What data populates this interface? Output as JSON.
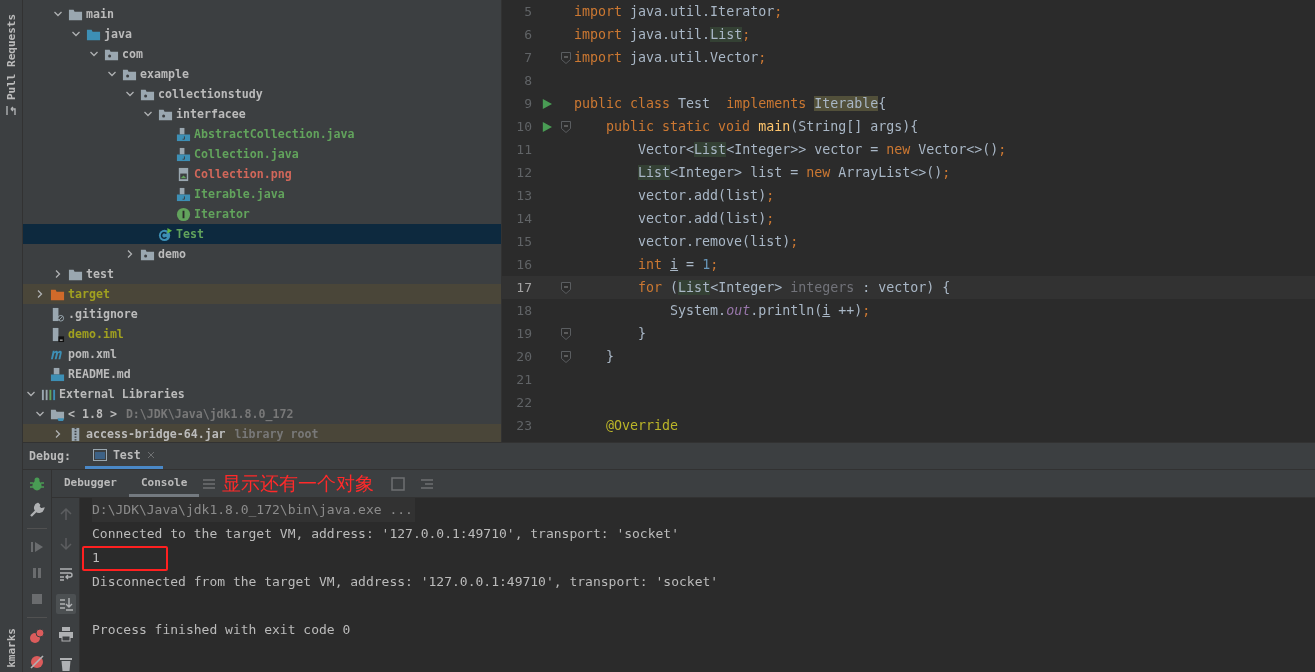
{
  "left_stripe": {
    "top_label": "Pull Requests",
    "bottom_label": "kmarks"
  },
  "project_tree": [
    {
      "children": [
        {
          "children": [
            {
              "label": "main",
              "kind": "folder",
              "expanded": true,
              "children": [
                {
                  "label": "java",
                  "kind": "source-folder",
                  "expanded": true,
                  "children": [
                    {
                      "label": "com",
                      "kind": "package",
                      "expanded": true,
                      "children": [
                        {
                          "label": "example",
                          "kind": "package",
                          "expanded": true,
                          "children": [
                            {
                              "label": "collectionstudy",
                              "kind": "package",
                              "expanded": true,
                              "children": [
                                {
                                  "label": "interfacee",
                                  "kind": "package",
                                  "expanded": true,
                                  "children": [
                                    {
                                      "label": "AbstractCollection.java",
                                      "kind": "java-file",
                                      "color": "#62a35c"
                                    },
                                    {
                                      "label": "Collection.java",
                                      "kind": "java-file",
                                      "color": "#62a35c"
                                    },
                                    {
                                      "label": "Collection.png",
                                      "kind": "image-file",
                                      "color": "#d1675a"
                                    },
                                    {
                                      "label": "Iterable.java",
                                      "kind": "java-file",
                                      "color": "#62a35c"
                                    },
                                    {
                                      "label": "Iterator",
                                      "kind": "interface",
                                      "color": "#62a35c"
                                    }
                                  ]
                                },
                                {
                                  "label": "Test",
                                  "kind": "class",
                                  "color": "#62a35c",
                                  "selected": true
                                }
                              ]
                            },
                            {
                              "label": "demo",
                              "kind": "package",
                              "expanded": false
                            }
                          ]
                        }
                      ]
                    }
                  ]
                }
              ]
            },
            {
              "label": "test",
              "kind": "folder",
              "expanded": false
            }
          ]
        },
        {
          "label": "target",
          "kind": "excluded-folder",
          "color": "#a0a020",
          "expanded": false,
          "highlighted": true
        },
        {
          "label": ".gitignore",
          "kind": "ignore-file"
        },
        {
          "label": "demo.iml",
          "kind": "iml-file",
          "color": "#a0a020"
        },
        {
          "label": "pom.xml",
          "kind": "maven"
        },
        {
          "label": "README.md",
          "kind": "markdown"
        }
      ]
    },
    {
      "label": "External Libraries",
      "kind": "library",
      "expanded": true,
      "children": [
        {
          "label": "< 1.8 >",
          "hint": "D:\\JDK\\Java\\jdk1.8.0_172",
          "kind": "jdk",
          "expanded": true,
          "children": [
            {
              "label": "access-bridge-64.jar",
              "hint": "library root",
              "kind": "jar",
              "expanded": false,
              "highlighted": true
            }
          ]
        }
      ]
    }
  ],
  "editor": {
    "lines": [
      {
        "number": "5",
        "tokens": [
          {
            "kind": "kw",
            "text": "import"
          },
          {
            "kind": "plain",
            "text": " java.util.Iterator"
          },
          {
            "kind": "punct",
            "text": ";"
          }
        ]
      },
      {
        "number": "6",
        "tokens": [
          {
            "kind": "kw",
            "text": "import"
          },
          {
            "kind": "plain",
            "text": " java.util."
          },
          {
            "kind": "ref",
            "text": "List"
          },
          {
            "kind": "punct",
            "text": ";"
          }
        ]
      },
      {
        "number": "7",
        "fold": true,
        "tokens": [
          {
            "kind": "kw",
            "text": "import"
          },
          {
            "kind": "plain",
            "text": " java.util.Vector"
          },
          {
            "kind": "punct",
            "text": ";"
          }
        ]
      },
      {
        "number": "8"
      },
      {
        "number": "9",
        "run": true,
        "tokens": [
          {
            "kind": "kw",
            "text": "public class"
          },
          {
            "kind": "plain",
            "text": " Test  "
          },
          {
            "kind": "kw",
            "text": "implements "
          },
          {
            "kind": "warn",
            "text": "Iterable"
          },
          {
            "kind": "plain",
            "text": "{"
          }
        ]
      },
      {
        "number": "10",
        "run": true,
        "fold": true,
        "tokens": [
          {
            "kind": "kw",
            "text": "    public static void "
          },
          {
            "kind": "method",
            "text": "main"
          },
          {
            "kind": "plain",
            "text": "(String[] args){"
          }
        ]
      },
      {
        "number": "11",
        "tokens": [
          {
            "kind": "plain",
            "text": "        Vector<"
          },
          {
            "kind": "ref",
            "text": "List"
          },
          {
            "kind": "plain",
            "text": "<Integer>> vector = "
          },
          {
            "kind": "kw",
            "text": "new"
          },
          {
            "kind": "plain",
            "text": " Vector<>()"
          },
          {
            "kind": "punct",
            "text": ";"
          }
        ]
      },
      {
        "number": "12",
        "tokens": [
          {
            "kind": "ref",
            "text": "        List"
          },
          {
            "kind": "plain",
            "text": "<Integer> list = "
          },
          {
            "kind": "kw",
            "text": "new"
          },
          {
            "kind": "plain",
            "text": " ArrayList<>()"
          },
          {
            "kind": "punct",
            "text": ";"
          }
        ]
      },
      {
        "number": "13",
        "tokens": [
          {
            "kind": "plain",
            "text": "        vector.add(list)"
          },
          {
            "kind": "punct",
            "text": ";"
          }
        ]
      },
      {
        "number": "14",
        "tokens": [
          {
            "kind": "plain",
            "text": "        vector.add(list)"
          },
          {
            "kind": "punct",
            "text": ";"
          }
        ]
      },
      {
        "number": "15",
        "tokens": [
          {
            "kind": "plain",
            "text": "        vector.remove(list)"
          },
          {
            "kind": "punct",
            "text": ";"
          }
        ]
      },
      {
        "number": "16",
        "tokens": [
          {
            "kind": "kw",
            "text": "        int "
          },
          {
            "kind": "var",
            "text": "i"
          },
          {
            "kind": "plain",
            "text": " = "
          },
          {
            "kind": "num",
            "text": "1"
          },
          {
            "kind": "punct",
            "text": ";"
          }
        ]
      },
      {
        "number": "17",
        "current": true,
        "fold": true,
        "tokens": [
          {
            "kind": "kw",
            "text": "        for"
          },
          {
            "kind": "plain",
            "text": " ("
          },
          {
            "kind": "ref",
            "text": "List"
          },
          {
            "kind": "plain",
            "text": "<Integer> "
          },
          {
            "kind": "unused",
            "text": "integers"
          },
          {
            "kind": "plain",
            "text": " : vector) {"
          }
        ]
      },
      {
        "number": "18",
        "tokens": [
          {
            "kind": "plain",
            "text": "            System."
          },
          {
            "kind": "field",
            "text": "out"
          },
          {
            "kind": "plain",
            "text": ".println("
          },
          {
            "kind": "var",
            "text": "i"
          },
          {
            "kind": "plain",
            "text": " ++)"
          },
          {
            "kind": "punct",
            "text": ";"
          }
        ]
      },
      {
        "number": "19",
        "fold": true,
        "tokens": [
          {
            "kind": "plain",
            "text": "        }"
          }
        ]
      },
      {
        "number": "20",
        "fold": true,
        "tokens": [
          {
            "kind": "plain",
            "text": "    }"
          }
        ]
      },
      {
        "number": "21"
      },
      {
        "number": "22"
      },
      {
        "number": "23",
        "tokens": [
          {
            "kind": "annotation",
            "text": "    @Override"
          }
        ]
      }
    ]
  },
  "debug": {
    "label": "Debug:",
    "tabs": [
      {
        "label": "Test",
        "selected": true
      }
    ],
    "actions": [
      {
        "kind": "bug",
        "disabled": false
      },
      {
        "kind": "wrench",
        "disabled": false
      },
      {
        "kind": "resume",
        "disabled": true
      },
      {
        "kind": "pause",
        "disabled": true
      },
      {
        "kind": "stop",
        "disabled": true
      },
      {
        "kind": "breakpoints",
        "disabled": false
      },
      {
        "kind": "mute",
        "disabled": false
      }
    ],
    "subtabs": [
      {
        "label": "Debugger",
        "selected": false
      },
      {
        "label": "Console",
        "selected": true
      }
    ],
    "tools": [
      {
        "kind": "up",
        "disabled": true
      },
      {
        "kind": "down",
        "disabled": true
      },
      {
        "kind": "wrap",
        "disabled": false
      },
      {
        "kind": "scroll-end",
        "disabled": false,
        "on": true
      },
      {
        "kind": "print",
        "disabled": false
      },
      {
        "kind": "trash",
        "disabled": false
      }
    ],
    "console": [
      {
        "kind": "command",
        "text": "D:\\JDK\\Java\\jdk1.8.0_172\\bin\\java.exe ..."
      },
      {
        "kind": "output",
        "text": "Connected to the target VM, address: '127.0.0.1:49710', transport: 'socket'"
      },
      {
        "kind": "output",
        "text": "1"
      },
      {
        "kind": "output",
        "text": "Disconnected from the target VM, address: '127.0.0.1:49710', transport: 'socket'"
      },
      {
        "kind": "exit",
        "text": "Process finished with exit code 0"
      }
    ],
    "annotation": {
      "text": "显示还有一个对象"
    }
  }
}
